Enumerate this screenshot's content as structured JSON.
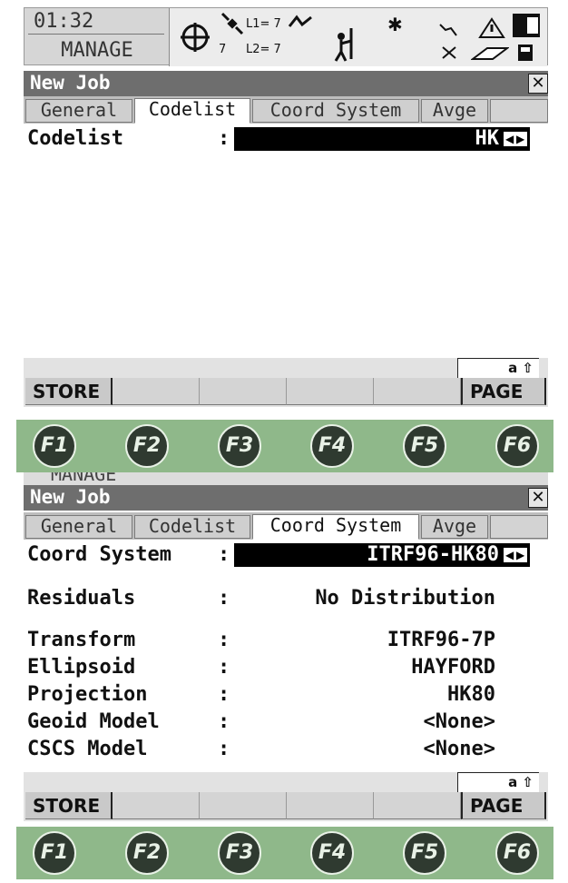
{
  "status": {
    "time": "01:32",
    "mode": "MANAGE",
    "sat_count": "7",
    "l1": "L1= 7",
    "l2": "L2= 7"
  },
  "screen1": {
    "title": "New Job",
    "tabs": [
      "General",
      "Codelist",
      "Coord System",
      "Avge",
      ""
    ],
    "active_tab": "Codelist",
    "fields": [
      {
        "label": "Codelist",
        "colon": ":",
        "value": "HK"
      }
    ],
    "mode_indicator": "a ⇧",
    "softkeys": [
      "STORE",
      "",
      "",
      "",
      "",
      "PAGE"
    ]
  },
  "screen2": {
    "title": "New Job",
    "header_partial": "MANAGE",
    "tabs": [
      "General",
      "Codelist",
      "Coord System",
      "Avge",
      ""
    ],
    "active_tab": "Coord System",
    "coord_system": {
      "label": "Coord System",
      "colon": ":",
      "value": "ITRF96-HK80"
    },
    "residuals": {
      "label": "Residuals",
      "colon": ":",
      "value": "No Distribution"
    },
    "fields": [
      {
        "label": "Transform",
        "colon": ":",
        "value": "ITRF96-7P"
      },
      {
        "label": "Ellipsoid",
        "colon": ":",
        "value": "HAYFORD"
      },
      {
        "label": "Projection",
        "colon": ":",
        "value": "HK80"
      },
      {
        "label": "Geoid Model",
        "colon": ":",
        "value": "<None>"
      },
      {
        "label": "CSCS Model",
        "colon": ":",
        "value": "<None>"
      }
    ],
    "mode_indicator": "a ⇧",
    "softkeys": [
      "STORE",
      "",
      "",
      "",
      "",
      "PAGE"
    ]
  },
  "function_keys": [
    "F1",
    "F2",
    "F3",
    "F4",
    "F5",
    "F6"
  ],
  "icons": [
    "crosshair-icon",
    "satellite-icon",
    "rover-icon",
    "bluetooth-icon",
    "radio-link-icon",
    "battery-icon",
    "memory-card-icon"
  ]
}
